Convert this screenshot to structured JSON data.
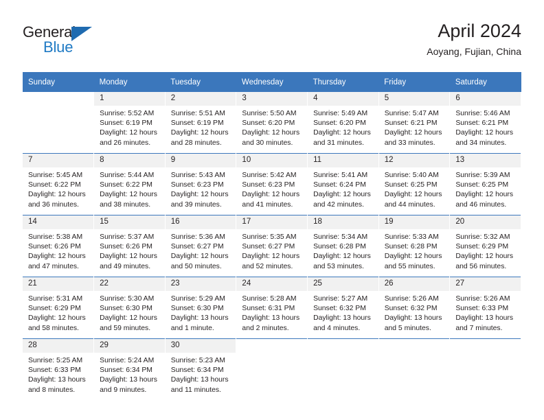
{
  "logo": {
    "word_top": "General",
    "word_bottom": "Blue",
    "triangle_color": "#1f6bb0",
    "bottom_color": "#1f7ac4"
  },
  "header": {
    "title": "April 2024",
    "subtitle": "Aoyang, Fujian, China",
    "header_bg": "#3b77bc",
    "daynum_bg": "#f1f1f1"
  },
  "weekday_headers": [
    "Sunday",
    "Monday",
    "Tuesday",
    "Wednesday",
    "Thursday",
    "Friday",
    "Saturday"
  ],
  "labels": {
    "sunrise": "Sunrise:",
    "sunset": "Sunset:",
    "daylight": "Daylight:"
  },
  "weeks": [
    [
      {
        "day": "",
        "empty": true
      },
      {
        "day": "1",
        "sunrise": "Sunrise: 5:52 AM",
        "sunset": "Sunset: 6:19 PM",
        "daylight1": "Daylight: 12 hours",
        "daylight2": "and 26 minutes."
      },
      {
        "day": "2",
        "sunrise": "Sunrise: 5:51 AM",
        "sunset": "Sunset: 6:19 PM",
        "daylight1": "Daylight: 12 hours",
        "daylight2": "and 28 minutes."
      },
      {
        "day": "3",
        "sunrise": "Sunrise: 5:50 AM",
        "sunset": "Sunset: 6:20 PM",
        "daylight1": "Daylight: 12 hours",
        "daylight2": "and 30 minutes."
      },
      {
        "day": "4",
        "sunrise": "Sunrise: 5:49 AM",
        "sunset": "Sunset: 6:20 PM",
        "daylight1": "Daylight: 12 hours",
        "daylight2": "and 31 minutes."
      },
      {
        "day": "5",
        "sunrise": "Sunrise: 5:47 AM",
        "sunset": "Sunset: 6:21 PM",
        "daylight1": "Daylight: 12 hours",
        "daylight2": "and 33 minutes."
      },
      {
        "day": "6",
        "sunrise": "Sunrise: 5:46 AM",
        "sunset": "Sunset: 6:21 PM",
        "daylight1": "Daylight: 12 hours",
        "daylight2": "and 34 minutes."
      }
    ],
    [
      {
        "day": "7",
        "sunrise": "Sunrise: 5:45 AM",
        "sunset": "Sunset: 6:22 PM",
        "daylight1": "Daylight: 12 hours",
        "daylight2": "and 36 minutes."
      },
      {
        "day": "8",
        "sunrise": "Sunrise: 5:44 AM",
        "sunset": "Sunset: 6:22 PM",
        "daylight1": "Daylight: 12 hours",
        "daylight2": "and 38 minutes."
      },
      {
        "day": "9",
        "sunrise": "Sunrise: 5:43 AM",
        "sunset": "Sunset: 6:23 PM",
        "daylight1": "Daylight: 12 hours",
        "daylight2": "and 39 minutes."
      },
      {
        "day": "10",
        "sunrise": "Sunrise: 5:42 AM",
        "sunset": "Sunset: 6:23 PM",
        "daylight1": "Daylight: 12 hours",
        "daylight2": "and 41 minutes."
      },
      {
        "day": "11",
        "sunrise": "Sunrise: 5:41 AM",
        "sunset": "Sunset: 6:24 PM",
        "daylight1": "Daylight: 12 hours",
        "daylight2": "and 42 minutes."
      },
      {
        "day": "12",
        "sunrise": "Sunrise: 5:40 AM",
        "sunset": "Sunset: 6:25 PM",
        "daylight1": "Daylight: 12 hours",
        "daylight2": "and 44 minutes."
      },
      {
        "day": "13",
        "sunrise": "Sunrise: 5:39 AM",
        "sunset": "Sunset: 6:25 PM",
        "daylight1": "Daylight: 12 hours",
        "daylight2": "and 46 minutes."
      }
    ],
    [
      {
        "day": "14",
        "sunrise": "Sunrise: 5:38 AM",
        "sunset": "Sunset: 6:26 PM",
        "daylight1": "Daylight: 12 hours",
        "daylight2": "and 47 minutes."
      },
      {
        "day": "15",
        "sunrise": "Sunrise: 5:37 AM",
        "sunset": "Sunset: 6:26 PM",
        "daylight1": "Daylight: 12 hours",
        "daylight2": "and 49 minutes."
      },
      {
        "day": "16",
        "sunrise": "Sunrise: 5:36 AM",
        "sunset": "Sunset: 6:27 PM",
        "daylight1": "Daylight: 12 hours",
        "daylight2": "and 50 minutes."
      },
      {
        "day": "17",
        "sunrise": "Sunrise: 5:35 AM",
        "sunset": "Sunset: 6:27 PM",
        "daylight1": "Daylight: 12 hours",
        "daylight2": "and 52 minutes."
      },
      {
        "day": "18",
        "sunrise": "Sunrise: 5:34 AM",
        "sunset": "Sunset: 6:28 PM",
        "daylight1": "Daylight: 12 hours",
        "daylight2": "and 53 minutes."
      },
      {
        "day": "19",
        "sunrise": "Sunrise: 5:33 AM",
        "sunset": "Sunset: 6:28 PM",
        "daylight1": "Daylight: 12 hours",
        "daylight2": "and 55 minutes."
      },
      {
        "day": "20",
        "sunrise": "Sunrise: 5:32 AM",
        "sunset": "Sunset: 6:29 PM",
        "daylight1": "Daylight: 12 hours",
        "daylight2": "and 56 minutes."
      }
    ],
    [
      {
        "day": "21",
        "sunrise": "Sunrise: 5:31 AM",
        "sunset": "Sunset: 6:29 PM",
        "daylight1": "Daylight: 12 hours",
        "daylight2": "and 58 minutes."
      },
      {
        "day": "22",
        "sunrise": "Sunrise: 5:30 AM",
        "sunset": "Sunset: 6:30 PM",
        "daylight1": "Daylight: 12 hours",
        "daylight2": "and 59 minutes."
      },
      {
        "day": "23",
        "sunrise": "Sunrise: 5:29 AM",
        "sunset": "Sunset: 6:30 PM",
        "daylight1": "Daylight: 13 hours",
        "daylight2": "and 1 minute."
      },
      {
        "day": "24",
        "sunrise": "Sunrise: 5:28 AM",
        "sunset": "Sunset: 6:31 PM",
        "daylight1": "Daylight: 13 hours",
        "daylight2": "and 2 minutes."
      },
      {
        "day": "25",
        "sunrise": "Sunrise: 5:27 AM",
        "sunset": "Sunset: 6:32 PM",
        "daylight1": "Daylight: 13 hours",
        "daylight2": "and 4 minutes."
      },
      {
        "day": "26",
        "sunrise": "Sunrise: 5:26 AM",
        "sunset": "Sunset: 6:32 PM",
        "daylight1": "Daylight: 13 hours",
        "daylight2": "and 5 minutes."
      },
      {
        "day": "27",
        "sunrise": "Sunrise: 5:26 AM",
        "sunset": "Sunset: 6:33 PM",
        "daylight1": "Daylight: 13 hours",
        "daylight2": "and 7 minutes."
      }
    ],
    [
      {
        "day": "28",
        "sunrise": "Sunrise: 5:25 AM",
        "sunset": "Sunset: 6:33 PM",
        "daylight1": "Daylight: 13 hours",
        "daylight2": "and 8 minutes."
      },
      {
        "day": "29",
        "sunrise": "Sunrise: 5:24 AM",
        "sunset": "Sunset: 6:34 PM",
        "daylight1": "Daylight: 13 hours",
        "daylight2": "and 9 minutes."
      },
      {
        "day": "30",
        "sunrise": "Sunrise: 5:23 AM",
        "sunset": "Sunset: 6:34 PM",
        "daylight1": "Daylight: 13 hours",
        "daylight2": "and 11 minutes."
      },
      {
        "day": "",
        "empty": true
      },
      {
        "day": "",
        "empty": true
      },
      {
        "day": "",
        "empty": true
      },
      {
        "day": "",
        "empty": true
      }
    ]
  ]
}
